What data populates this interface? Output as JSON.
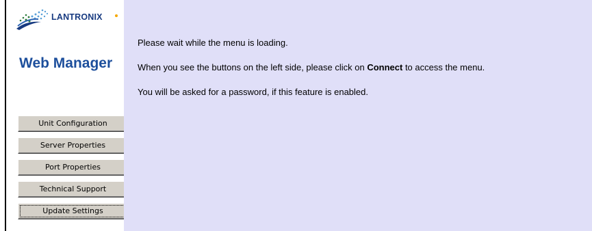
{
  "logo": {
    "brand": "LANTRONIX",
    "product": "Web Manager"
  },
  "nav": {
    "items": [
      {
        "label": "Unit Configuration"
      },
      {
        "label": "Server Properties"
      },
      {
        "label": "Port Properties"
      },
      {
        "label": "Technical Support"
      },
      {
        "label": "Update Settings"
      }
    ]
  },
  "content": {
    "line1": "Please wait while the menu is loading.",
    "line2_pre": "When you see the buttons on the left side, please click on ",
    "line2_bold": "Connect",
    "line2_post": " to access the menu.",
    "line3": "You will be asked for a password, if this feature is enabled."
  },
  "colors": {
    "content_bg": "#e0dff8",
    "button_face": "#d4d0c8",
    "brand_blue": "#1d4f9c"
  }
}
